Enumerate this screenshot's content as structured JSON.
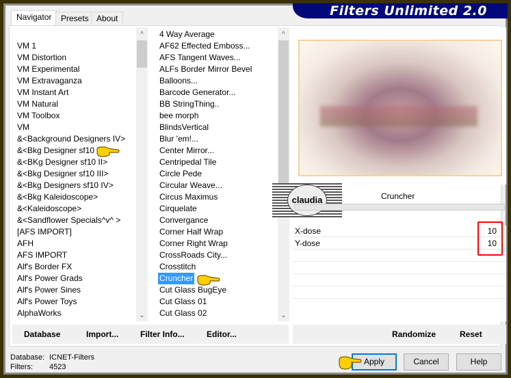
{
  "title": "Filters Unlimited 2.0",
  "tabs": [
    {
      "label": "Navigator",
      "active": true
    },
    {
      "label": "Presets"
    },
    {
      "label": "About"
    }
  ],
  "categories": [
    "VM 1",
    "VM Distortion",
    "VM Experimental",
    "VM Extravaganza",
    "VM Instant Art",
    "VM Natural",
    "VM Toolbox",
    "VM",
    "&<Background Designers IV>",
    "&<Bkg Designer sf10 I>",
    "&<BKg Designer sf10 II>",
    "&<Bkg Designer sf10 III>",
    "&<Bkg Designers sf10 IV>",
    "&<Bkg Kaleidoscope>",
    "&<Kaleidoscope>",
    "&<Sandflower Specials^v^ >",
    "[AFS IMPORT]",
    "AFH",
    "AFS IMPORT",
    "Alf's Border FX",
    "Alf's Power Grads",
    "Alf's Power Sines",
    "Alf's Power Toys",
    "AlphaWorks"
  ],
  "filters": [
    "4 Way Average",
    "AF62 Effected Emboss...",
    "AFS Tangent Waves...",
    "ALFs Border Mirror Bevel",
    "Balloons...",
    "Barcode Generator...",
    "BB StringThing..",
    "bee morph",
    "BlindsVertical",
    "Blur 'em!...",
    "Center Mirror...",
    "Centripedal Tile",
    "Circle Pede",
    "Circular Weave...",
    "Circus Maximus",
    "Cirquelate",
    "Convergance",
    "Corner Half Wrap",
    "Corner Right Wrap",
    "CrossRoads City...",
    "Crosstitch",
    "Cruncher",
    "Cut Glass  BugEye",
    "Cut Glass 01",
    "Cut Glass 02"
  ],
  "selected_filter": "Cruncher",
  "filter_name": "Cruncher",
  "params": [
    {
      "label": "X-dose",
      "value": "10"
    },
    {
      "label": "Y-dose",
      "value": "10"
    }
  ],
  "watermark": "claudia",
  "buttons": {
    "database": "Database",
    "import": "Import...",
    "filter_info": "Filter Info...",
    "editor": "Editor...",
    "randomize": "Randomize",
    "reset": "Reset",
    "apply": "Apply",
    "cancel": "Cancel",
    "help": "Help"
  },
  "status": {
    "database_label": "Database:",
    "database_value": "ICNET-Filters",
    "filters_label": "Filters:",
    "filters_value": "4523"
  },
  "colors": {
    "banner": "#00087a",
    "selection": "#3399ff",
    "highlight_box": "#ff0000"
  }
}
